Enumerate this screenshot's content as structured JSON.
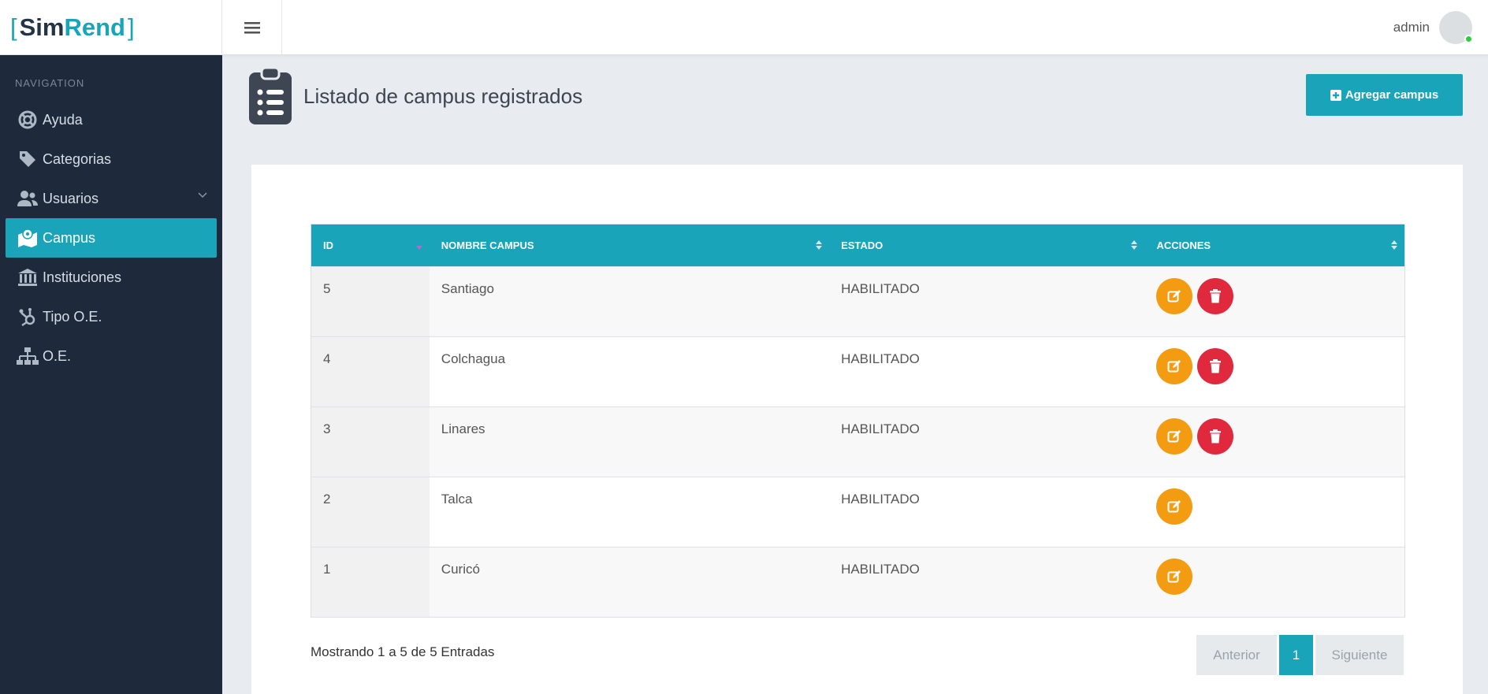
{
  "brand": {
    "open": "[",
    "sim": "Sim",
    "rend": "Rend",
    "close": "]"
  },
  "header": {
    "user_name": "admin"
  },
  "sidebar": {
    "title": "NAVIGATION",
    "items": [
      {
        "label": "Ayuda",
        "icon": "lifebuoy-icon"
      },
      {
        "label": "Categorias",
        "icon": "tag-icon"
      },
      {
        "label": "Usuarios",
        "icon": "users-icon"
      },
      {
        "label": "Campus",
        "icon": "map-marker-icon"
      },
      {
        "label": "Instituciones",
        "icon": "institution-icon"
      },
      {
        "label": "Tipo O.E.",
        "icon": "hubspot-icon"
      },
      {
        "label": "O.E.",
        "icon": "sitemap-icon"
      }
    ],
    "active": "Campus"
  },
  "page": {
    "title": "Listado de campus registrados",
    "add_button": "Agregar campus"
  },
  "table": {
    "columns": [
      "ID",
      "NOMBRE CAMPUS",
      "ESTADO",
      "ACCIONES"
    ],
    "rows": [
      {
        "id": "5",
        "name": "Santiago",
        "status": "HABILITADO",
        "can_delete": true
      },
      {
        "id": "4",
        "name": "Colchagua",
        "status": "HABILITADO",
        "can_delete": true
      },
      {
        "id": "3",
        "name": "Linares",
        "status": "HABILITADO",
        "can_delete": true
      },
      {
        "id": "2",
        "name": "Talca",
        "status": "HABILITADO",
        "can_delete": false
      },
      {
        "id": "1",
        "name": "Curicó",
        "status": "HABILITADO",
        "can_delete": false
      }
    ]
  },
  "footer": {
    "info": "Mostrando 1 a 5 de 5 Entradas",
    "prev": "Anterior",
    "current_page": "1",
    "next": "Siguiente"
  },
  "colors": {
    "accent": "#19a4b9",
    "sidebar": "#1e2a3b",
    "edit": "#f39c12",
    "delete": "#e0293d"
  }
}
